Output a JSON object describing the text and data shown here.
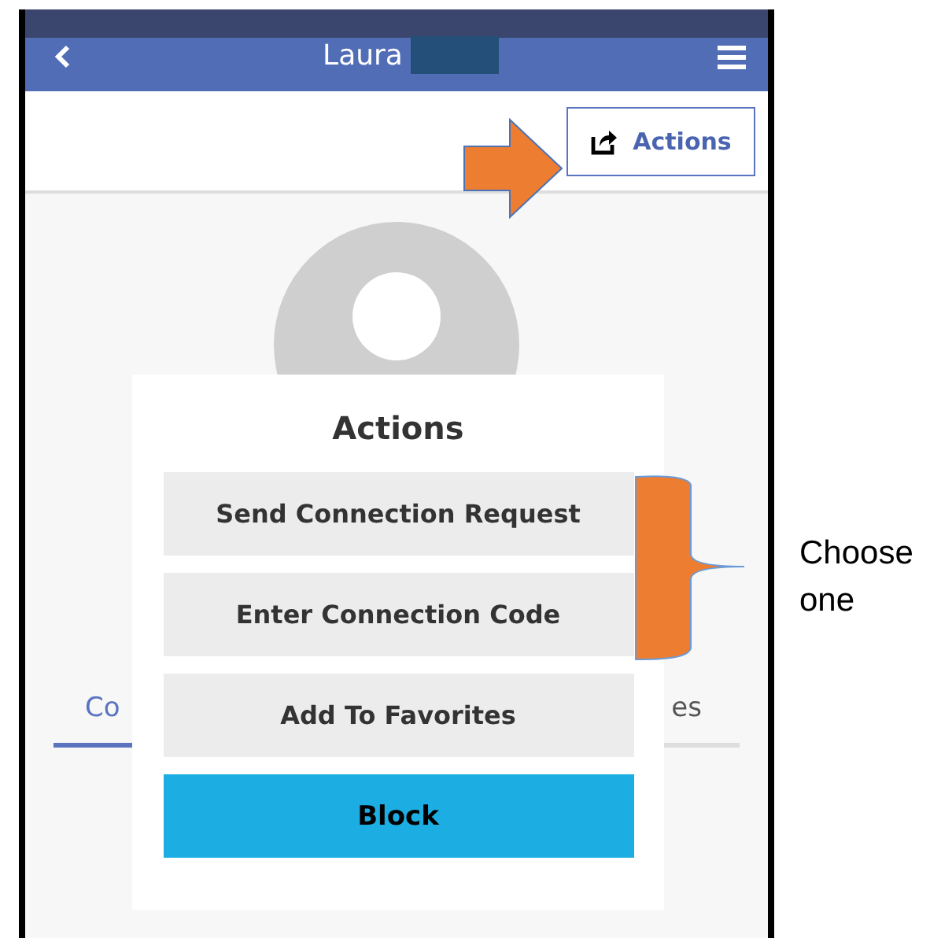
{
  "header": {
    "title": "Laura"
  },
  "toolbar": {
    "action_button": "Actions"
  },
  "profile_tabs": [
    {
      "label": "Co",
      "selected": true
    },
    {
      "label": "es",
      "selected": false
    }
  ],
  "dialog": {
    "title": "Actions",
    "options": [
      {
        "label": "Send Connection Request",
        "kind": "option"
      },
      {
        "label": "Enter Connection Code",
        "kind": "option"
      },
      {
        "label": "Add To Favorites",
        "kind": "option"
      },
      {
        "label": "Block",
        "kind": "danger"
      }
    ]
  },
  "annotation": {
    "note": "Choose one"
  }
}
